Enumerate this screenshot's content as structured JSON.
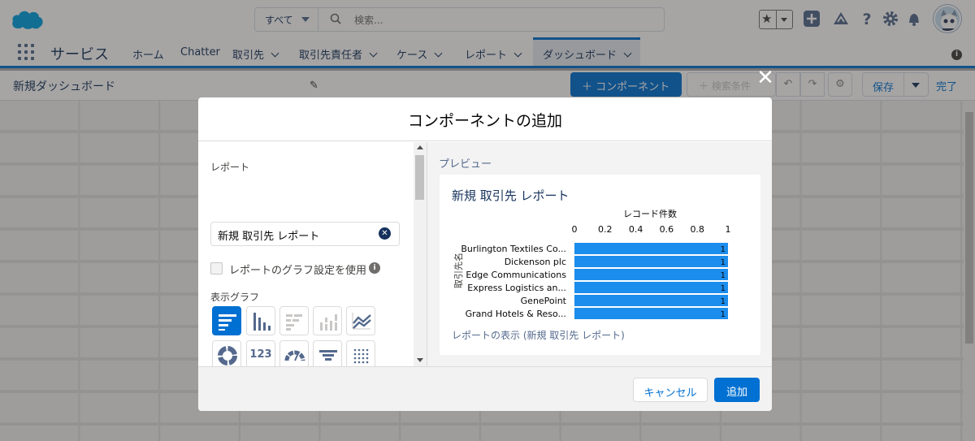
{
  "header": {
    "search_scope": "すべて",
    "search_placeholder": "検索..."
  },
  "nav": {
    "app_name": "サービス",
    "tabs": [
      {
        "label": "ホーム"
      },
      {
        "label": "Chatter"
      },
      {
        "label": "取引先"
      },
      {
        "label": "取引先責任者"
      },
      {
        "label": "ケース"
      },
      {
        "label": "レポート"
      },
      {
        "label": "ダッシュボード"
      }
    ]
  },
  "dashboard": {
    "title": "新規ダッシュボード",
    "component_button": "コンポーネント",
    "filter_button": "検索条件",
    "save_button": "保存",
    "done_button": "完了"
  },
  "modal": {
    "title": "コンポーネントの追加",
    "report_label": "レポート",
    "report_value": "新規 取引先 レポート",
    "use_chart_settings_label": "レポートのグラフ設定を使用",
    "use_chart_settings_checked": false,
    "display_chart_label": "表示グラフ",
    "chart_types": [
      "horizontal-bar",
      "vertical-bar",
      "stacked-horizontal-bar",
      "stacked-vertical-bar",
      "line",
      "donut",
      "metric",
      "gauge",
      "funnel",
      "scatter",
      "table"
    ],
    "selected_chart_type": "horizontal-bar",
    "metric_label": "123",
    "preview_label": "プレビュー",
    "preview_title": "新規 取引先 レポート",
    "view_report_link": "レポートの表示 (新規 取引先 レポート)",
    "cancel_button": "キャンセル",
    "add_button": "追加"
  },
  "chart_data": {
    "type": "bar",
    "orientation": "horizontal",
    "title": "",
    "xlabel": "レコード件数",
    "ylabel": "取引先名",
    "categories": [
      "Burlington Textiles Co...",
      "Dickenson plc",
      "Edge Communications",
      "Express Logistics an...",
      "GenePoint",
      "Grand Hotels & Reso..."
    ],
    "values": [
      1,
      1,
      1,
      1,
      1,
      1
    ],
    "xlim": [
      0,
      1
    ],
    "xticks": [
      "0",
      "0.2",
      "0.4",
      "0.6",
      "0.8",
      "1"
    ],
    "bar_color": "#1b8ded"
  }
}
